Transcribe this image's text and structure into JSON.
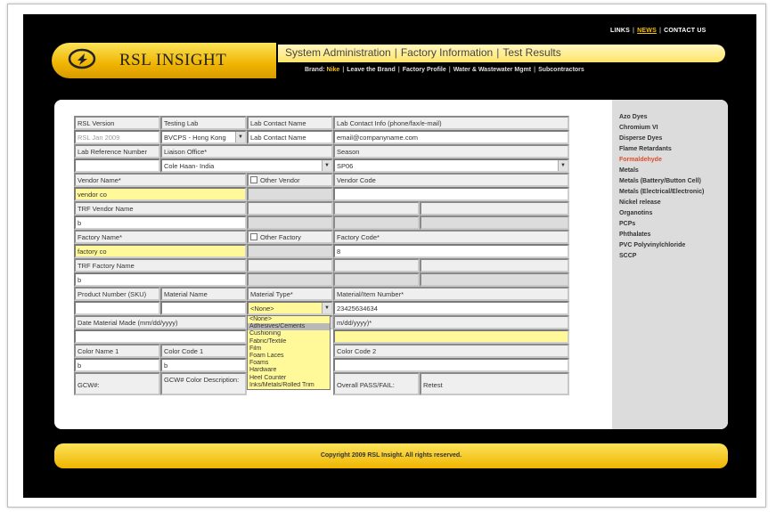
{
  "top_links": [
    "LINKS",
    "NEWS",
    "CONTACT US"
  ],
  "brand_name": "RSL INSIGHT",
  "main_nav": [
    "System Administration",
    "Factory Information",
    "Test Results"
  ],
  "sub_nav": {
    "brand_label": "Brand:",
    "brand_value": "Nike",
    "items": [
      "Leave the Brand",
      "Factory Profile",
      "Water & Wastewater Mgmt",
      "Subcontractors"
    ]
  },
  "form": {
    "rsl_version_label": "RSL Version",
    "testing_lab_label": "Testing Lab",
    "lab_contact_name_label": "Lab Contact Name",
    "lab_contact_info_label": "Lab Contact Info (phone/fax/e-mail)",
    "rsl_version_value": "RSL Jan 2009",
    "testing_lab_value": "BVCPS - Hong Kong",
    "lab_contact_name_value": "Lab Contact Name",
    "lab_contact_info_value": "email@companyname.com",
    "lab_reference_label": "Lab Reference Number",
    "liaison_office_label": "Liaison Office*",
    "season_label": "Season",
    "liaison_office_value": "Cole Haan- India",
    "season_value": "SP06",
    "vendor_name_label": "Vendor Name*",
    "other_vendor_label": "Other Vendor",
    "vendor_code_label": "Vendor Code",
    "vendor_name_value": "vendor co",
    "trf_vendor_name_label": "TRF Vendor Name",
    "trf_vendor_name_value": "b",
    "factory_name_label": "Factory Name*",
    "other_factory_label": "Other Factory",
    "factory_code_label": "Factory Code*",
    "factory_name_value": "factory co",
    "factory_code_value": "8",
    "trf_factory_name_label": "TRF Factory Name",
    "trf_factory_name_value": "b",
    "product_number_label": "Product Number (SKU)",
    "material_name_label": "Material Name",
    "material_type_label": "Material Type*",
    "material_item_number_label": "Material/Item Number*",
    "material_type_value": "<None>",
    "material_item_number_value": "23425634634",
    "date_material_made_label": "Date Material Made (mm/dd/yyyy)",
    "date_right_label": "m/dd/yyyy)*",
    "color_name_1_label": "Color Name 1",
    "color_code_1_label": "Color Code 1",
    "color_code_2_label": "Color Code 2",
    "color_name_1_value": "b",
    "color_code_1_value": "b",
    "gcw_label": "GCW#:",
    "gcw_color_desc_label": "GCW# Color Description:",
    "overall_pass_fail_label": "Overall PASS/FAIL:",
    "retest_label": "Retest"
  },
  "material_type_options": [
    "<None>",
    "Adhesives/Cements",
    "Cushioning",
    "Fabric/Textile",
    "Film",
    "Foam Laces",
    "Foams",
    "Hardware",
    "Heel Counter",
    "Inks/Metals/Rolled Trim"
  ],
  "sidebar_items": [
    "Azo Dyes",
    "Chromium VI",
    "Disperse Dyes",
    "Flame Retardants",
    "Formaldehyde",
    "Metals",
    "Metals (Battery/Button Cell)",
    "Metals (Electrical/Electronic)",
    "Nickel release",
    "Organotins",
    "PCPs",
    "Phthalates",
    "PVC Polyvinylchloride",
    "SCCP"
  ],
  "sidebar_active": "Formaldehyde",
  "footer_text": "Copyright 2009 RSL Insight. All rights reserved.",
  "colors": {
    "accent": "#f0b400",
    "active_link": "#e14a2a",
    "field_highlight": "#fff99a"
  }
}
